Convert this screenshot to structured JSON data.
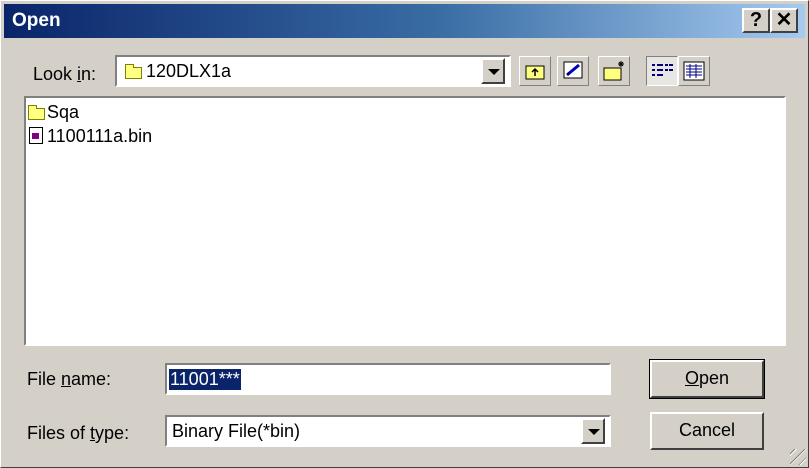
{
  "window": {
    "title": "Open",
    "help_label": "?",
    "close_label": "✕"
  },
  "look_in": {
    "label_pre": "Look ",
    "label_key": "i",
    "label_post": "n:",
    "value": "120DLX1a"
  },
  "toolbar": {
    "icons": [
      "up-one-level-icon",
      "desktop-icon",
      "new-folder-icon",
      "list-view-icon",
      "details-view-icon"
    ]
  },
  "files": [
    {
      "name": "Sqa",
      "type": "folder"
    },
    {
      "name": "1100111a.bin",
      "type": "file"
    }
  ],
  "file_name": {
    "label_pre": "File ",
    "label_key": "n",
    "label_post": "ame:",
    "value": "11001***"
  },
  "file_type": {
    "label_pre": "Files of ",
    "label_key": "t",
    "label_post": "ype:",
    "value": "Binary File(*bin)"
  },
  "buttons": {
    "open_key": "O",
    "open_rest": "pen",
    "cancel": "Cancel"
  },
  "colors": {
    "titlebar_start": "#0a246a",
    "titlebar_end": "#a6caf0",
    "face": "#d4d0c8",
    "selection": "#0a246a"
  }
}
